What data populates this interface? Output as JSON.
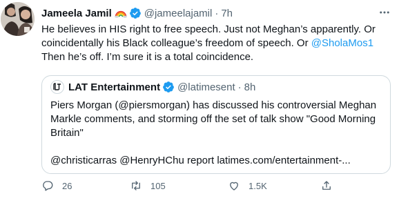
{
  "tweet": {
    "author_name": "Jameela Jamil",
    "author_handle": "@jameelajamil",
    "separator": "·",
    "time": "7h",
    "body_lines": {
      "l1": "He believes in HIS right to free speech. Just not Meghan’s apparently. Or",
      "l2_pre": "coincidentally his Black colleague’s freedom of speech. Or ",
      "l2_mention": "@SholaMos1",
      "l3": "Then he’s off. I’m sure it is a total coincidence."
    }
  },
  "quote": {
    "author_name": "LAT Entertainment",
    "author_handle": "@latimesent",
    "separator": "·",
    "time": "8h",
    "body_lines": {
      "l1": "Piers Morgan (@piersmorgan) has discussed his controversial Meghan",
      "l2": "Markle comments, and storming off the set of talk show \"Good Morning",
      "l3": "Britain\"",
      "l4": "@christicarras @HenryHChu report latimes.com/entertainment-..."
    }
  },
  "actions": {
    "reply_count": "26",
    "retweet_count": "105",
    "like_count": "1.5K"
  },
  "icons": {
    "more": "more-icon",
    "reply": "reply-icon",
    "retweet": "retweet-icon",
    "like": "like-icon",
    "share": "share-icon",
    "verified": "verified-badge-icon",
    "rainbow": "rainbow-emoji-icon",
    "quote_logo": "lat-logo-icon"
  },
  "colors": {
    "link": "#1d9bf0",
    "muted": "#536471",
    "text": "#0f1419",
    "border": "#cfd9de"
  }
}
